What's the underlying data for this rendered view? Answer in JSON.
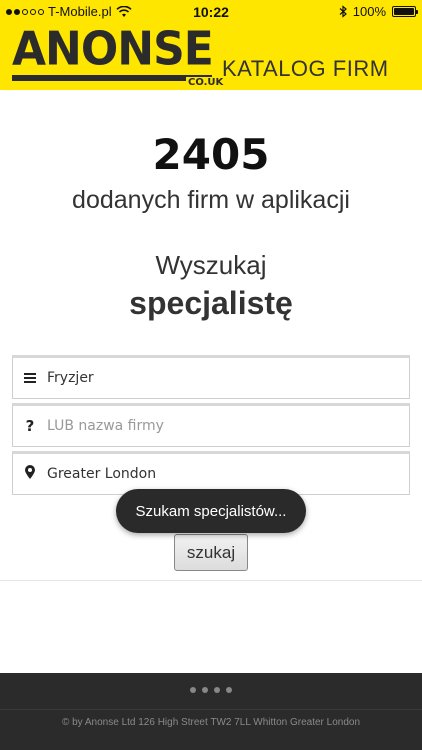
{
  "status_bar": {
    "carrier": "T-Mobile.pl",
    "time": "10:22",
    "battery": "100%",
    "signal_bars": 2,
    "battery_level": 1.0
  },
  "header": {
    "logo_text": "ANONSE",
    "logo_suffix": "CO.UK",
    "tagline": "KATALOG FIRM",
    "color": "#ffe600"
  },
  "stats": {
    "count": "2405",
    "label": "dodanych firm w aplikacji"
  },
  "search": {
    "title_line1": "Wyszukaj",
    "title_line2": "specjalistę",
    "category": {
      "icon": "menu-icon",
      "value": "Fryzjer",
      "placeholder": ""
    },
    "company": {
      "icon": "question-icon",
      "value": "",
      "placeholder": "LUB nazwa firmy"
    },
    "location": {
      "icon": "location-pin-icon",
      "value": "Greater London",
      "placeholder": ""
    },
    "submit_label": "szukaj"
  },
  "toast": {
    "text": "Szukam specjalistów..."
  },
  "footer": {
    "copyright": "© by Anonse Ltd 126 High Street TW2 7LL Whitton Greater London",
    "page_dots": 4
  }
}
